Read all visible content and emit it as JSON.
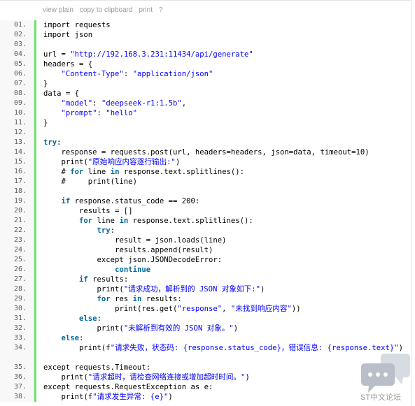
{
  "toolbar": {
    "view_plain": "view plain",
    "copy": "copy to clipboard",
    "print": "print",
    "help": "?"
  },
  "lines": [
    {
      "n": "01.",
      "t": [
        [
          "p",
          "import requests"
        ]
      ]
    },
    {
      "n": "02.",
      "t": [
        [
          "p",
          "import json"
        ]
      ]
    },
    {
      "n": "03.",
      "t": []
    },
    {
      "n": "04.",
      "t": [
        [
          "p",
          "url = "
        ],
        [
          "s",
          "\"http://192.168.3.231:11434/api/generate\""
        ]
      ]
    },
    {
      "n": "05.",
      "t": [
        [
          "p",
          "headers = {"
        ]
      ]
    },
    {
      "n": "06.",
      "t": [
        [
          "p",
          "    "
        ],
        [
          "s",
          "\"Content-Type\""
        ],
        [
          "p",
          ": "
        ],
        [
          "s",
          "\"application/json\""
        ]
      ]
    },
    {
      "n": "07.",
      "t": [
        [
          "p",
          "}"
        ]
      ]
    },
    {
      "n": "08.",
      "t": [
        [
          "p",
          "data = {"
        ]
      ]
    },
    {
      "n": "09.",
      "t": [
        [
          "p",
          "    "
        ],
        [
          "s",
          "\"model\""
        ],
        [
          "p",
          ": "
        ],
        [
          "s",
          "\"deepseek-r1:1.5b\""
        ],
        [
          "p",
          ","
        ]
      ]
    },
    {
      "n": "10.",
      "t": [
        [
          "p",
          "    "
        ],
        [
          "s",
          "\"prompt\""
        ],
        [
          "p",
          ": "
        ],
        [
          "s",
          "\"hello\""
        ]
      ]
    },
    {
      "n": "11.",
      "t": [
        [
          "p",
          "}"
        ]
      ]
    },
    {
      "n": "12.",
      "t": []
    },
    {
      "n": "13.",
      "t": [
        [
          "k",
          "try"
        ],
        [
          "p",
          ":"
        ]
      ]
    },
    {
      "n": "14.",
      "t": [
        [
          "p",
          "    response = requests.post(url, headers=headers, json=data, timeout=10)"
        ]
      ]
    },
    {
      "n": "15.",
      "t": [
        [
          "p",
          "    print("
        ],
        [
          "s",
          "\"原始响应内容逐行输出:\""
        ],
        [
          "p",
          ")"
        ]
      ]
    },
    {
      "n": "16.",
      "t": [
        [
          "p",
          "    # "
        ],
        [
          "k",
          "for"
        ],
        [
          "p",
          " line "
        ],
        [
          "k",
          "in"
        ],
        [
          "p",
          " response.text.splitlines():"
        ]
      ]
    },
    {
      "n": "17.",
      "t": [
        [
          "p",
          "    #     print(line)"
        ]
      ]
    },
    {
      "n": "18.",
      "t": []
    },
    {
      "n": "19.",
      "t": [
        [
          "p",
          "    "
        ],
        [
          "k",
          "if"
        ],
        [
          "p",
          " response.status_code == 200:"
        ]
      ]
    },
    {
      "n": "20.",
      "t": [
        [
          "p",
          "        results = []"
        ]
      ]
    },
    {
      "n": "21.",
      "t": [
        [
          "p",
          "        "
        ],
        [
          "k",
          "for"
        ],
        [
          "p",
          " line "
        ],
        [
          "k",
          "in"
        ],
        [
          "p",
          " response.text.splitlines():"
        ]
      ]
    },
    {
      "n": "22.",
      "t": [
        [
          "p",
          "            "
        ],
        [
          "k",
          "try"
        ],
        [
          "p",
          ":"
        ]
      ]
    },
    {
      "n": "23.",
      "t": [
        [
          "p",
          "                result = json.loads(line)"
        ]
      ]
    },
    {
      "n": "24.",
      "t": [
        [
          "p",
          "                results.append(result)"
        ]
      ]
    },
    {
      "n": "25.",
      "t": [
        [
          "p",
          "            except json.JSONDecodeError:"
        ]
      ]
    },
    {
      "n": "26.",
      "t": [
        [
          "p",
          "                "
        ],
        [
          "k",
          "continue"
        ]
      ]
    },
    {
      "n": "27.",
      "t": [
        [
          "p",
          "        "
        ],
        [
          "k",
          "if"
        ],
        [
          "p",
          " results:"
        ]
      ]
    },
    {
      "n": "28.",
      "t": [
        [
          "p",
          "            print("
        ],
        [
          "s",
          "\"请求成功，解析到的 JSON 对象如下:\""
        ],
        [
          "p",
          ")"
        ]
      ]
    },
    {
      "n": "29.",
      "t": [
        [
          "p",
          "            "
        ],
        [
          "k",
          "for"
        ],
        [
          "p",
          " res "
        ],
        [
          "k",
          "in"
        ],
        [
          "p",
          " results:"
        ]
      ]
    },
    {
      "n": "30.",
      "t": [
        [
          "p",
          "                print(res.get("
        ],
        [
          "s",
          "\"response\""
        ],
        [
          "p",
          ", "
        ],
        [
          "s",
          "\"未找到响应内容\""
        ],
        [
          "p",
          "))"
        ]
      ]
    },
    {
      "n": "31.",
      "t": [
        [
          "p",
          "        "
        ],
        [
          "k",
          "else"
        ],
        [
          "p",
          ":"
        ]
      ]
    },
    {
      "n": "32.",
      "t": [
        [
          "p",
          "            print("
        ],
        [
          "s",
          "\"未解析到有效的 JSON 对象。\""
        ],
        [
          "p",
          ")"
        ]
      ]
    },
    {
      "n": "33.",
      "t": [
        [
          "p",
          "    "
        ],
        [
          "k",
          "else"
        ],
        [
          "p",
          ":"
        ]
      ]
    },
    {
      "n": "34.",
      "wrap": true,
      "t": [
        [
          "p",
          "        print(f"
        ],
        [
          "s",
          "\"请求失败，状态码: {response.status_code}，错误信息: {response.text}\""
        ],
        [
          "p",
          ")"
        ]
      ]
    },
    {
      "n": "35.",
      "t": [
        [
          "p",
          "except requests.Timeout:"
        ]
      ]
    },
    {
      "n": "36.",
      "t": [
        [
          "p",
          "    print("
        ],
        [
          "s",
          "\"请求超时，请检查网络连接或增加超时时间。\""
        ],
        [
          "p",
          ")"
        ]
      ]
    },
    {
      "n": "37.",
      "t": [
        [
          "p",
          "except requests.RequestException as e:"
        ]
      ]
    },
    {
      "n": "38.",
      "t": [
        [
          "p",
          "    print(f"
        ],
        [
          "s",
          "\"请求发生异常: {e}\""
        ],
        [
          "p",
          ")"
        ]
      ]
    }
  ],
  "watermark": {
    "text": "ST中文论坛",
    "icon": "chat-bubbles-icon",
    "color": "#c4c9d2"
  }
}
